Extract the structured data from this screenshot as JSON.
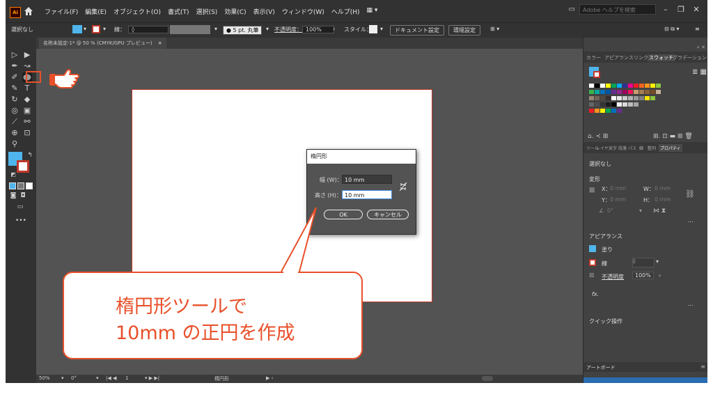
{
  "menubar": {
    "logo": "Ai",
    "items": [
      "ファイル(F)",
      "編集(E)",
      "オブジェクト(O)",
      "書式(T)",
      "選択(S)",
      "効果(C)",
      "表示(V)",
      "ウィンドウ(W)",
      "ヘルプ(H)"
    ],
    "help_placeholder": "Adobe ヘルプを検索"
  },
  "controlbar": {
    "selection": "選択なし",
    "stroke_label": "線：",
    "brush": "5 pt. 丸筆",
    "opacity_label": "不透明度：",
    "opacity_value": "100%",
    "style_label": "スタイル：",
    "doc_settings": "ドキュメント設定",
    "prefs": "環境設定"
  },
  "document_tab": {
    "label": "名称未設定-1* @ 50 % (CMYK/GPU プレビュー)",
    "close": "×"
  },
  "statusbar": {
    "zoom": "50%",
    "rotation": "0°",
    "artboard_num": "1",
    "tool": "楕円形"
  },
  "panel": {
    "tabs": [
      "カラー",
      "アピアランス",
      "リンク",
      "スウォッチ",
      "グラデーション"
    ],
    "active_tab": "スウォッチ",
    "prop_tabs": [
      "ツール",
      "レイヤー",
      "文字",
      "段落",
      "パス",
      "線",
      "整列",
      "プロパティ"
    ],
    "no_selection": "選択なし",
    "transform_title": "変形",
    "x_label": "X：",
    "x_value": "0 mm",
    "y_label": "Y：",
    "y_value": "0 mm",
    "w_label": "W：",
    "w_value": "0 mm",
    "h_label": "H：",
    "h_value": "0 mm",
    "angle_value": "0°",
    "appearance_title": "アピアランス",
    "fill_label": "塗り",
    "stroke_label": "線",
    "opacity_label": "不透明度",
    "opacity_value": "100%",
    "fx_label": "fx.",
    "quick_actions": "クイック操作",
    "artboard_tab": "アートボード",
    "more": "..."
  },
  "dialog": {
    "title": "楕円形",
    "width_label": "幅 (W)：",
    "width_value": "10 mm",
    "height_label": "高さ (H)：",
    "height_value": "10 mm",
    "ok": "OK",
    "cancel": "キャンセル"
  },
  "callout": {
    "line1": "楕円形ツールで",
    "line2": "10mm の正円を作成"
  },
  "colors": {
    "accent": "#e8502a",
    "fill_blue": "#4fb5ec",
    "app_bg": "#535353",
    "bar_bg": "#323232"
  }
}
